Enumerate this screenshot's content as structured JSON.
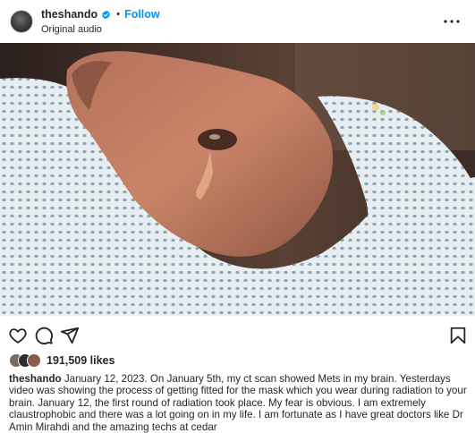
{
  "post": {
    "username": "theshando",
    "dot": "•",
    "follow_label": "Follow",
    "audio": "Original audio",
    "image_alt": "Close-up photo of a person lying down wearing a white mesh radiation mask",
    "likes": "191,509 likes",
    "caption_user": "theshando",
    "caption_text": "January 12, 2023. On January 5th, my ct scan showed Mets in my brain. Yesterdays video was showing the process of getting fitted for the mask which you wear during radiation to your brain. January 12, the first round of radiation took place. My fear is obvious. I am extremely claustrophobic and there was a lot going on in my life. I am fortunate as I have great doctors like Dr Amin Mirahdi and the amazing techs at cedar"
  },
  "icons": {
    "verified": "verified-badge-icon",
    "more": "more-options-icon",
    "like": "heart-icon",
    "comment": "comment-icon",
    "share": "share-icon",
    "save": "bookmark-icon"
  },
  "colors": {
    "follow": "#0095f6",
    "verified": "#0095f6",
    "text": "#262626"
  }
}
